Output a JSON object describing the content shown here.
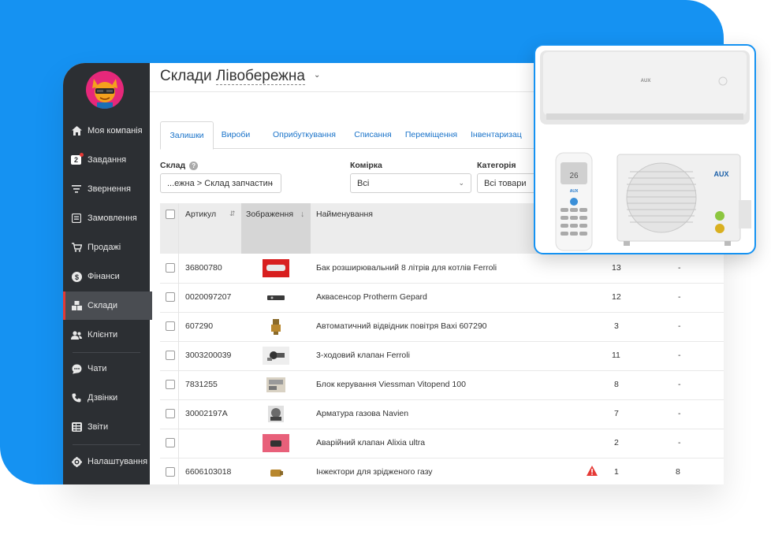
{
  "sidebar": {
    "items": [
      {
        "label": "Моя компанія",
        "icon": "home-icon"
      },
      {
        "label": "Завдання",
        "icon": "tasks-icon",
        "badge": "2"
      },
      {
        "label": "Звернення",
        "icon": "filter-icon"
      },
      {
        "label": "Замовлення",
        "icon": "orders-icon"
      },
      {
        "label": "Продажі",
        "icon": "cart-icon"
      },
      {
        "label": "Фінанси",
        "icon": "dollar-icon"
      },
      {
        "label": "Склади",
        "icon": "boxes-icon",
        "active": true
      },
      {
        "label": "Клієнти",
        "icon": "users-icon"
      },
      {
        "label": "Чати",
        "icon": "chat-icon"
      },
      {
        "label": "Дзвінки",
        "icon": "phone-icon"
      },
      {
        "label": "Звіти",
        "icon": "reports-icon"
      },
      {
        "label": "Налаштування",
        "icon": "gear-icon"
      }
    ]
  },
  "header": {
    "title_prefix": "Склади",
    "title_selected": "Лівобережна"
  },
  "tabs": [
    {
      "label": "Залишки",
      "active": true
    },
    {
      "label": "Вироби"
    },
    {
      "label": "Оприбуткування"
    },
    {
      "label": "Списання"
    },
    {
      "label": "Переміщення"
    },
    {
      "label": "Інвентаризац"
    }
  ],
  "filters": {
    "warehouse": {
      "label": "Склад",
      "value": "...ежна > Склад запчастин"
    },
    "cell": {
      "label": "Комірка",
      "value": "Всі"
    },
    "category": {
      "label": "Категорія",
      "value": "Всі товари"
    }
  },
  "table": {
    "headers": {
      "article": "Артикул",
      "image": "Зображення",
      "name": "Найменування"
    },
    "rows": [
      {
        "article": "36800780",
        "name": "Бак розширювальний 8 літрів для котлів Ferroli",
        "qty": "13",
        "extra": "-",
        "thumb": "#d81f1f"
      },
      {
        "article": "0020097207",
        "name": "Аквасенсор Protherm Gepard",
        "qty": "12",
        "extra": "-",
        "thumb": "#3a3a3a"
      },
      {
        "article": "607290",
        "name": "Автоматичний відвідник повітря Baxi 607290",
        "qty": "3",
        "extra": "-",
        "thumb": "#b8872e"
      },
      {
        "article": "3003200039",
        "name": "3-ходовий клапан Ferroli",
        "qty": "11",
        "extra": "-",
        "thumb": "#555555"
      },
      {
        "article": "7831255",
        "name": "Блок керування Viessman Vitopend 100",
        "qty": "8",
        "extra": "-",
        "thumb": "#9a9a9a"
      },
      {
        "article": "30002197A",
        "name": "Арматура газова Navien",
        "qty": "7",
        "extra": "-",
        "thumb": "#6b6b6b"
      },
      {
        "article": "",
        "name": "Аварійний клапан Alixia ultra",
        "qty": "2",
        "extra": "-",
        "thumb": "#e8607a"
      },
      {
        "article": "6606103018",
        "name": "Інжектори для зрідженого газу",
        "qty": "1",
        "extra": "8",
        "thumb": "#b8872e",
        "warning": true
      }
    ]
  },
  "popup": {
    "brand": "AUX",
    "remote_display": "26"
  },
  "colors": {
    "background": "#1592f2",
    "sidebar": "#2c2f33",
    "link": "#1a73c9",
    "warning": "#e53935"
  }
}
